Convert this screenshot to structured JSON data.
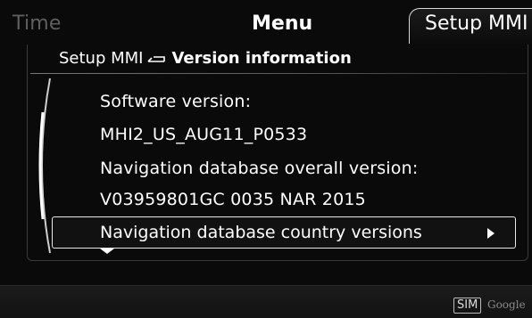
{
  "tabs": [
    {
      "label": "Time"
    },
    {
      "label": "Menu"
    },
    {
      "label": "Setup MMI"
    }
  ],
  "breadcrumb": {
    "parent": "Setup MMI",
    "current": "Version information",
    "separator_icon": "back-arrow-icon"
  },
  "rows": {
    "software_label": "Software version:",
    "software_value": "MHI2_US_AUG11_P0533",
    "nav_overall_label": "Navigation database overall version:",
    "nav_overall_value": "V03959801GC 0035 NAR 2015",
    "nav_country_label": "Navigation database country versions"
  },
  "status": {
    "sim": "SIM",
    "provider": "Google"
  },
  "colors": {
    "background": "#0a0a0a",
    "text": "#ffffff",
    "inactive_tab": "#5f5f5f",
    "highlight_border": "#e8e8e8"
  }
}
